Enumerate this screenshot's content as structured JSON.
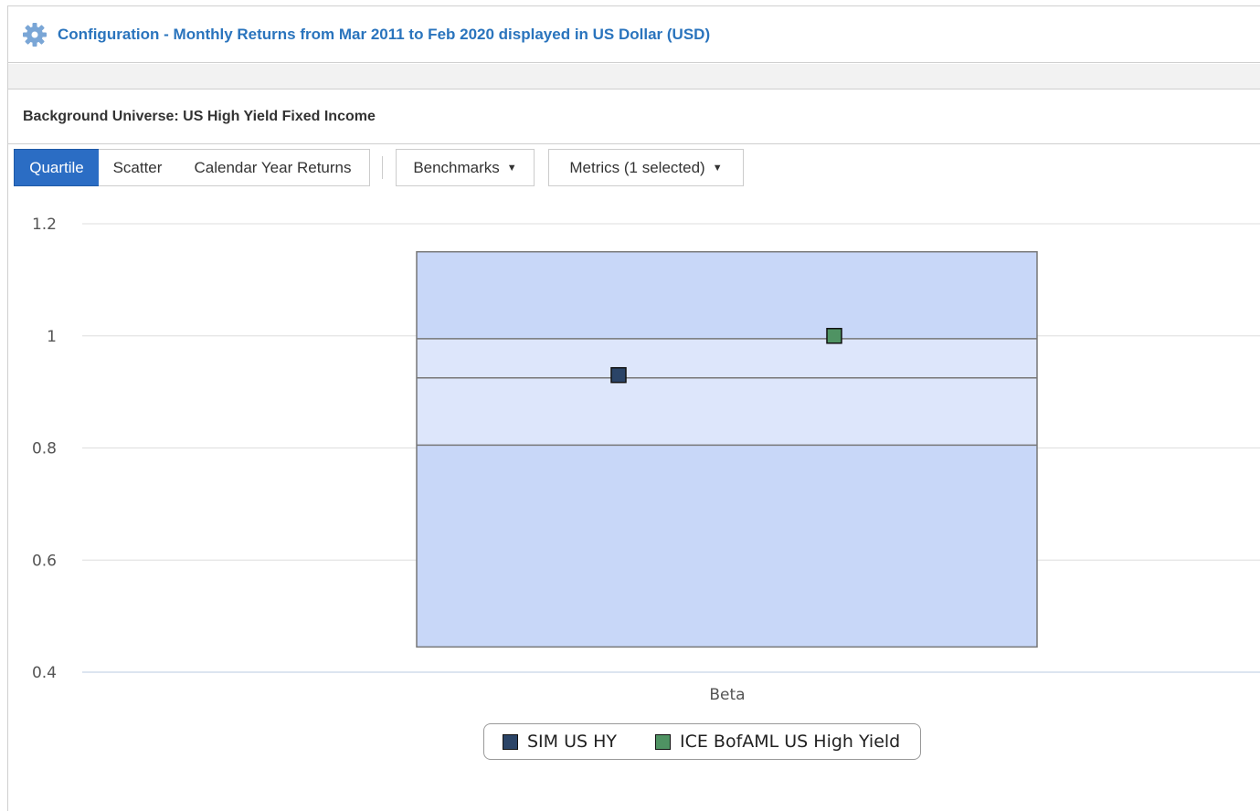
{
  "config": {
    "title": "Configuration - Monthly Returns from Mar 2011 to Feb 2020 displayed in US Dollar (USD)",
    "icon": "gear-icon"
  },
  "universe": {
    "title": "Background Universe: US High Yield Fixed Income"
  },
  "toolbar": {
    "tabs": [
      {
        "label": "Quartile",
        "active": true
      },
      {
        "label": "Scatter",
        "active": false
      },
      {
        "label": "Calendar Year Returns",
        "active": false
      }
    ],
    "benchmarks_label": "Benchmarks",
    "metrics_label": "Metrics (1 selected)",
    "caret_icon": "caret-down-icon"
  },
  "colors": {
    "accent": "#2b6dc4",
    "link": "#2a74bd",
    "outer_quartile": "#c8d7f8",
    "inner_quartile": "#dde6fb",
    "sim_us_hy": "#2b4467",
    "ice_bofaml": "#4f9363"
  },
  "chart_data": {
    "type": "box",
    "category": "Beta",
    "ylim": [
      0.4,
      1.2
    ],
    "yticks": [
      "1.2",
      "1",
      "0.8",
      "0.6",
      "0.4"
    ],
    "ytick_values": [
      1.2,
      1.0,
      0.8,
      0.6,
      0.4
    ],
    "grid": true,
    "box": {
      "max": 1.15,
      "q3": 0.995,
      "median": 0.925,
      "q1": 0.805,
      "min": 0.445
    },
    "series": [
      {
        "name": "SIM US HY",
        "value": 0.93
      },
      {
        "name": "ICE BofAML US High Yield",
        "value": 1.0
      }
    ],
    "legend_position": "bottom-center"
  }
}
